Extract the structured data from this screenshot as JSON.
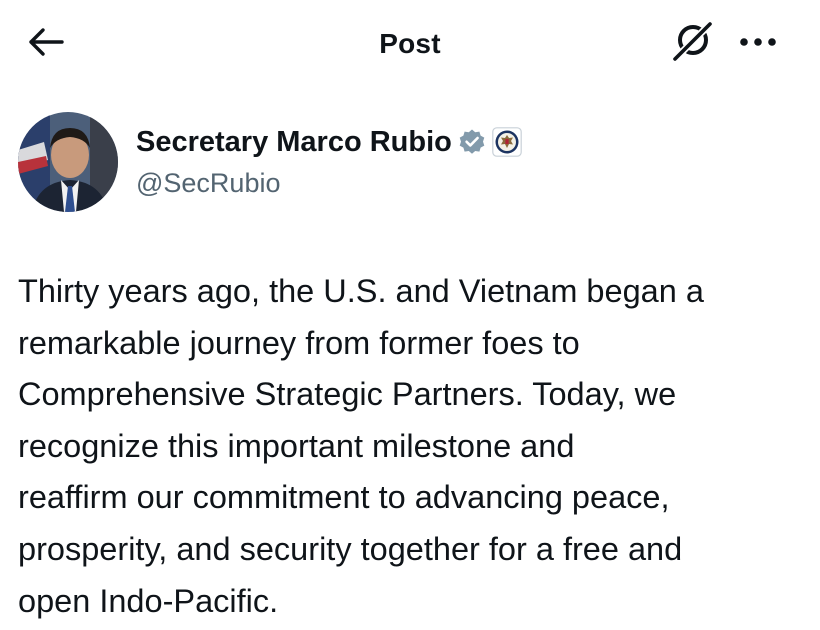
{
  "header": {
    "title": "Post",
    "back_icon": "arrow-left-icon",
    "grok_icon": "grok-icon",
    "more_icon": "more-horizontal-icon"
  },
  "author": {
    "display_name": "Secretary Marco Rubio",
    "handle": "@SecRubio",
    "verified_icon": "verified-badge-icon",
    "verified_color": "#829aab",
    "affiliation_icon": "department-of-state-seal-icon"
  },
  "post": {
    "text": "Thirty years ago, the U.S. and Vietnam began a\nremarkable journey from former foes to\nComprehensive Strategic Partners. Today, we\nrecognize this important milestone and\nreaffirm our commitment to advancing peace,\nprosperity, and security together for a free and\nopen Indo-Pacific."
  },
  "colors": {
    "text_primary": "#0f1419",
    "text_secondary": "#536471",
    "background": "#ffffff"
  }
}
